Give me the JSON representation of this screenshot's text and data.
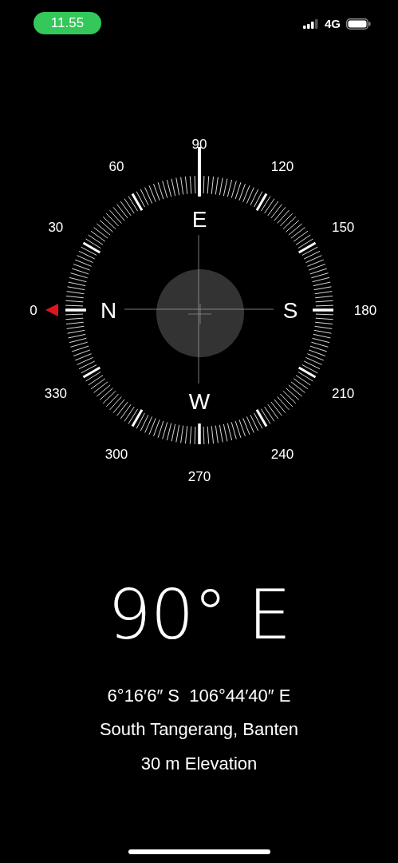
{
  "status_bar": {
    "time": "11.55",
    "network": "4G"
  },
  "compass": {
    "degree_labels": [
      "0",
      "30",
      "60",
      "90",
      "120",
      "150",
      "180",
      "210",
      "240",
      "270",
      "300",
      "330"
    ],
    "cardinals": [
      "N",
      "E",
      "S",
      "W"
    ]
  },
  "heading": "90° E",
  "coordinates": "6°16′6″ S  106°44′40″ E",
  "location": "South Tangerang, Banten",
  "elevation": "30 m Elevation"
}
